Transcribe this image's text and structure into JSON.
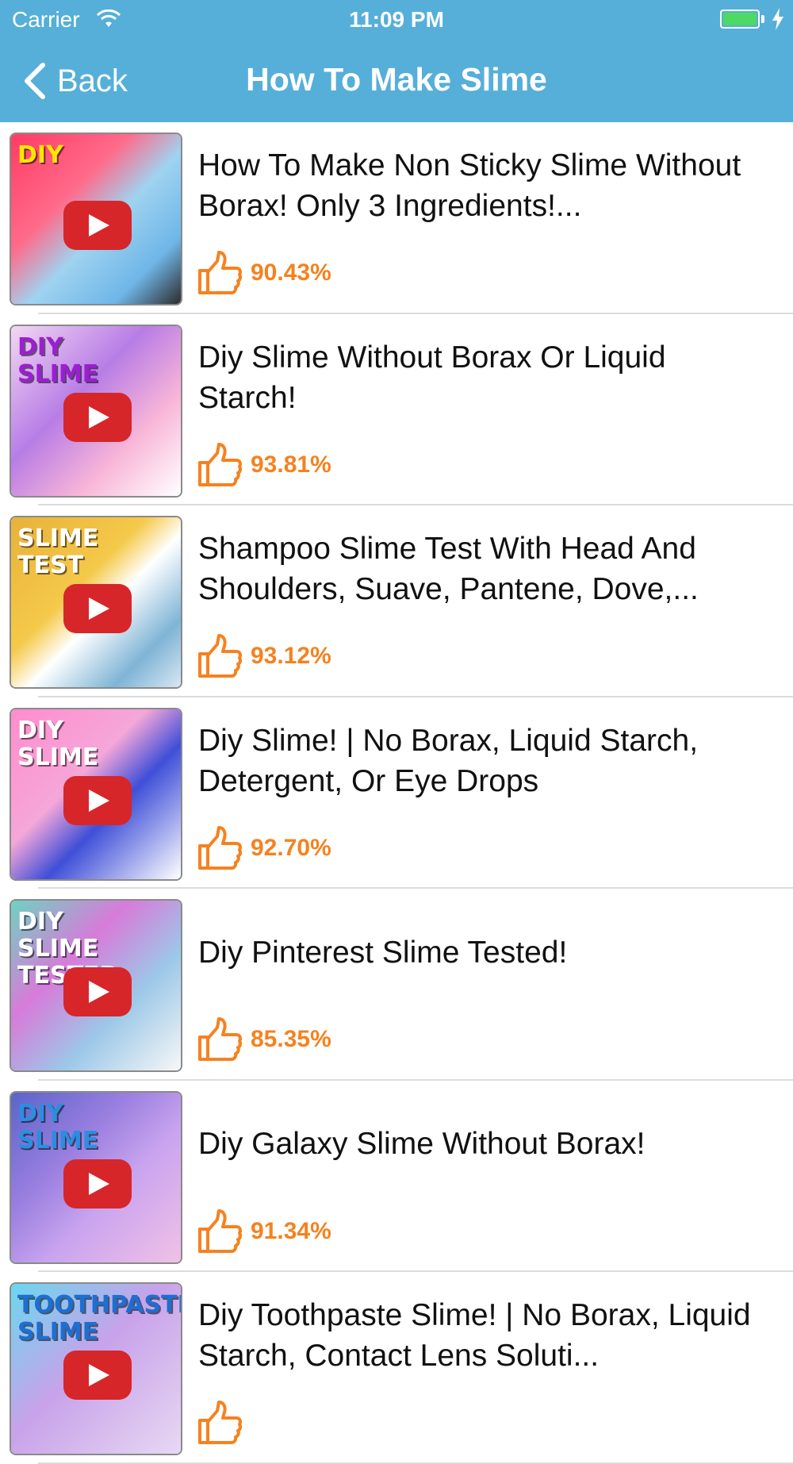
{
  "status_bar": {
    "carrier": "Carrier",
    "time": "11:09 PM",
    "battery_icon": "battery-charging-icon",
    "wifi_icon": "wifi-icon"
  },
  "nav": {
    "back_label": "Back",
    "title": "How To Make Slime"
  },
  "colors": {
    "header": "#55afd9",
    "rating": "#f5821f",
    "play_button": "#d6262a"
  },
  "videos": [
    {
      "title": "How To Make Non Sticky Slime Without Borax! Only 3 Ingredients!...",
      "rating": "90.43%",
      "thumb_text": "DIY"
    },
    {
      "title": "Diy Slime Without Borax Or Liquid Starch!",
      "rating": "93.81%",
      "thumb_text": "DIY SLIME"
    },
    {
      "title": "Shampoo Slime Test With Head And Shoulders, Suave, Pantene, Dove,...",
      "rating": "93.12%",
      "thumb_text": "SLIME TEST"
    },
    {
      "title": "Diy Slime! | No Borax, Liquid Starch, Detergent, Or Eye Drops",
      "rating": "92.70%",
      "thumb_text": "DIY SLIME"
    },
    {
      "title": "Diy Pinterest Slime Tested!",
      "rating": "85.35%",
      "thumb_text": "DIY SLIME TESTED"
    },
    {
      "title": "Diy Galaxy Slime Without Borax!",
      "rating": "91.34%",
      "thumb_text": "DIY SLIME"
    },
    {
      "title": "Diy Toothpaste Slime! | No Borax, Liquid Starch, Contact Lens Soluti...",
      "rating": "",
      "thumb_text": "TOOTHPASTE SLIME"
    }
  ]
}
